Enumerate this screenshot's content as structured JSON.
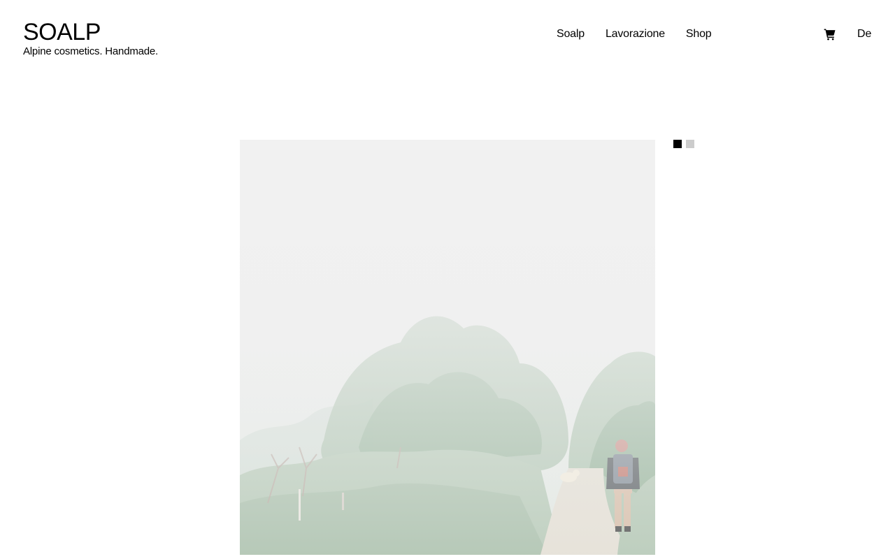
{
  "brand": {
    "title": "SOALP",
    "tagline": "Alpine cosmetics. Handmade."
  },
  "nav": {
    "items": [
      {
        "label": "Soalp"
      },
      {
        "label": "Lavorazione"
      },
      {
        "label": "Shop"
      }
    ],
    "cart_icon": "cart-icon",
    "language": "De"
  },
  "slider": {
    "current_slide": 1,
    "total_slides": 2,
    "image_subject": "misty alpine forest with hiker and dog on a trail"
  },
  "colors": {
    "text": "#000000",
    "dot_active": "#000000",
    "dot_inactive": "#cccccc",
    "background": "#ffffff"
  }
}
